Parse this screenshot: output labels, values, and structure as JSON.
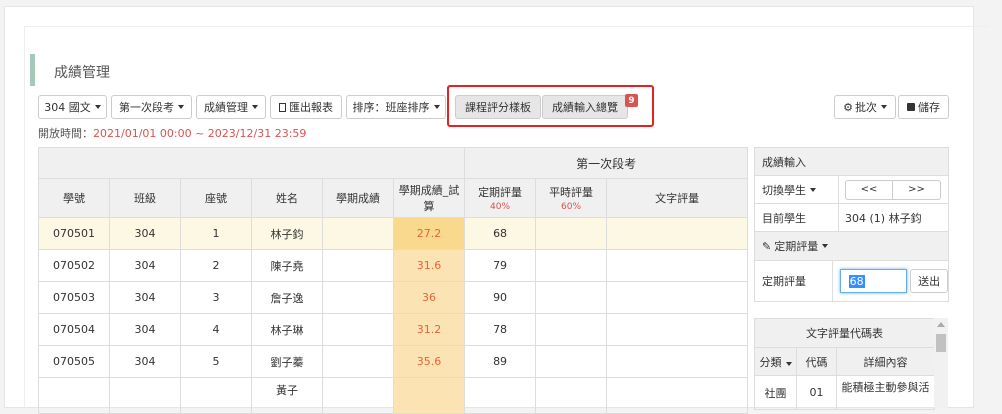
{
  "page": {
    "title": "成績管理"
  },
  "toolbar": {
    "class_select": "304 國文",
    "exam_select": "第一次段考",
    "manage_select": "成績管理",
    "export_label": "匯出報表",
    "sort_select": "排序：班座排序",
    "template_label": "課程評分樣板",
    "overview_label": "成績輸入總覽",
    "overview_badge": "9",
    "batch_label": "批次",
    "save_label": "儲存"
  },
  "open_time": {
    "label": "開放時間：",
    "value": "2021/01/01 00:00 ~ 2023/12/31 23:59"
  },
  "grade_table": {
    "group_header": "第一次段考",
    "columns": {
      "student_no": "學號",
      "class": "班級",
      "seat": "座號",
      "name": "姓名",
      "semester_score": "學期成績",
      "semester_trial": "學期成績_試算",
      "periodic": "定期評量",
      "periodic_pct": "40%",
      "regular": "平時評量",
      "regular_pct": "60%",
      "text_eval": "文字評量"
    },
    "rows": [
      {
        "student_no": "070501",
        "class": "304",
        "seat": "1",
        "name": "林子鈞",
        "semester_score": "",
        "trial": "27.2",
        "periodic": "68",
        "regular": "",
        "text": ""
      },
      {
        "student_no": "070502",
        "class": "304",
        "seat": "2",
        "name": "陳子堯",
        "semester_score": "",
        "trial": "31.6",
        "periodic": "79",
        "regular": "",
        "text": ""
      },
      {
        "student_no": "070503",
        "class": "304",
        "seat": "3",
        "name": "詹子逸",
        "semester_score": "",
        "trial": "36",
        "periodic": "90",
        "regular": "",
        "text": ""
      },
      {
        "student_no": "070504",
        "class": "304",
        "seat": "4",
        "name": "林子琳",
        "semester_score": "",
        "trial": "31.2",
        "periodic": "78",
        "regular": "",
        "text": ""
      },
      {
        "student_no": "070505",
        "class": "304",
        "seat": "5",
        "name": "劉子蓁",
        "semester_score": "",
        "trial": "35.6",
        "periodic": "89",
        "regular": "",
        "text": ""
      },
      {
        "student_no": "",
        "class": "",
        "seat": "",
        "name": "黃子",
        "semester_score": "",
        "trial": "",
        "periodic": "",
        "regular": "",
        "text": ""
      }
    ]
  },
  "side_panel": {
    "heading": "成績輸入",
    "switch_label": "切換學生",
    "prev_label": "<<",
    "next_label": ">>",
    "current_label": "目前學生",
    "current_value": "304 (1) 林子鈞",
    "eval_select": "定期評量",
    "field_label": "定期評量",
    "field_value": "68",
    "send_label": "送出"
  },
  "code_table": {
    "title": "文字評量代碼表",
    "col_category": "分類",
    "col_code": "代碼",
    "col_detail": "詳細內容",
    "rows": [
      {
        "category": "社團",
        "code": "01",
        "detail": "能積極主動參與活"
      }
    ]
  }
}
